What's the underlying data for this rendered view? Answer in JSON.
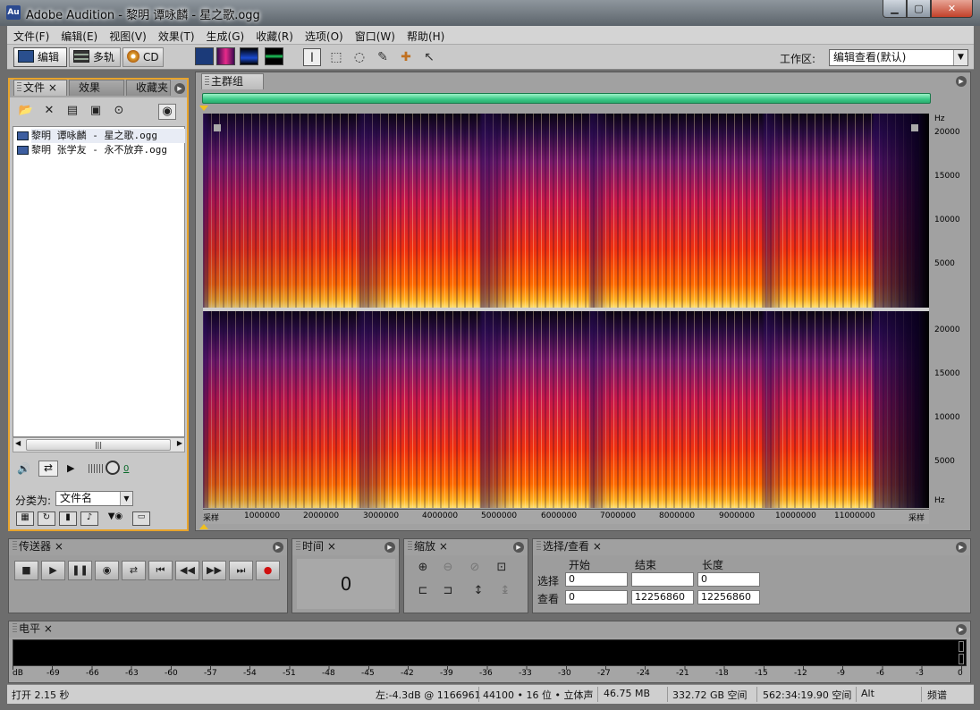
{
  "window": {
    "title": "Adobe Audition - 黎明 谭咏麟 - 星之歌.ogg",
    "icon_text": "Au"
  },
  "menu": [
    "文件(F)",
    "编辑(E)",
    "视图(V)",
    "效果(T)",
    "生成(G)",
    "收藏(R)",
    "选项(O)",
    "窗口(W)",
    "帮助(H)"
  ],
  "toolbar": {
    "edit_label": "编辑",
    "multitrack_label": "多轨",
    "cd_label": "CD",
    "workspace_label": "工作区:",
    "workspace_value": "编辑查看(默认)"
  },
  "files_panel": {
    "tabs": [
      "文件",
      "效果",
      "收藏夹"
    ],
    "files": [
      "黎明 谭咏麟 - 星之歌.ogg",
      "黎明 张学友 - 永不放弃.ogg"
    ],
    "volume_value": "0",
    "sort_label": "分类为:",
    "sort_value": "文件名"
  },
  "main": {
    "tab_label": "主群组",
    "freq_unit": "Hz",
    "freq_ticks": [
      "20000",
      "15000",
      "10000",
      "5000"
    ],
    "time_start": "采样",
    "time_end": "采样",
    "time_ticks": [
      "1000000",
      "2000000",
      "3000000",
      "4000000",
      "5000000",
      "6000000",
      "7000000",
      "8000000",
      "9000000",
      "10000000",
      "11000000"
    ]
  },
  "transport": {
    "title": "传送器"
  },
  "time_panel": {
    "title": "时间",
    "value": "0"
  },
  "zoom_panel": {
    "title": "缩放"
  },
  "selection_panel": {
    "title": "选择/查看",
    "col_start": "开始",
    "col_end": "结束",
    "col_length": "长度",
    "row_selection": "选择",
    "row_view": "查看",
    "sel_start": "0",
    "sel_end": "",
    "sel_length": "0",
    "view_start": "0",
    "view_end": "12256860",
    "view_length": "12256860"
  },
  "level_panel": {
    "title": "电平",
    "db_ticks": [
      "dB",
      "-69",
      "-66",
      "-63",
      "-60",
      "-57",
      "-54",
      "-51",
      "-48",
      "-45",
      "-42",
      "-39",
      "-36",
      "-33",
      "-30",
      "-27",
      "-24",
      "-21",
      "-18",
      "-15",
      "-12",
      "-9",
      "-6",
      "-3",
      "0"
    ]
  },
  "status": {
    "open_time": "打开 2.15 秒",
    "level_info": "左:-4.3dB @ 1166961",
    "format": "44100 • 16 位 • 立体声",
    "size": "46.75 MB",
    "free_space": "332.72 GB 空间",
    "free_time": "562:34:19.90 空间",
    "alt": "Alt",
    "view_mode": "频谱"
  },
  "colors": {
    "spectrum_hot": "#ff2a00",
    "spectrum_cool": "#3a1a6e",
    "panel_focus": "#e8a42c",
    "progress": "#3ac886"
  }
}
